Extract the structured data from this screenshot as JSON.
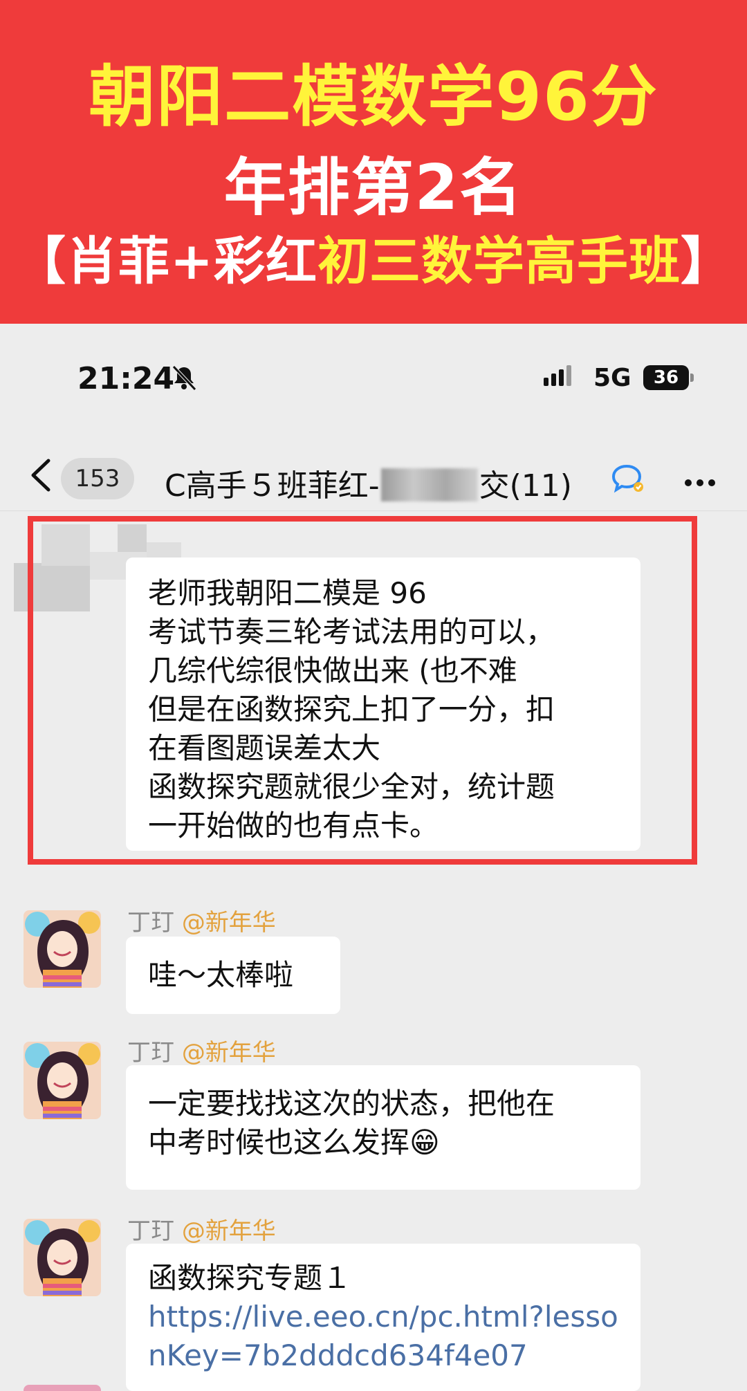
{
  "banner": {
    "line1": "朝阳二模数学96分",
    "line2": "年排第2名",
    "line3_white": "【肖菲+彩红",
    "line3_yellow": "初三数学高手班",
    "line3_end": "】",
    "colors": {
      "background": "#ef3b3b",
      "yellow": "#fff43a",
      "white": "#ffffff"
    }
  },
  "status_bar": {
    "time": "21:24",
    "network": "5G",
    "battery": "36",
    "icons": [
      "bell-muted-icon",
      "signal-icon",
      "battery-icon"
    ]
  },
  "chat_header": {
    "unread_count": "153",
    "title_prefix": "C高手５班菲红-",
    "title_suffix": "交",
    "title_tail": "(11)",
    "icons": [
      "back-arrow-icon",
      "chat-bubble-icon",
      "more-icon"
    ]
  },
  "messages": [
    {
      "highlighted": true,
      "lines": [
        "老师我朝阳二模是 96",
        "考试节奏三轮考试法用的可以，",
        "几综代综很快做出来 (也不难",
        "但是在函数探究上扣了一分，扣",
        "在看图题误差太大",
        "函数探究题就很少全对，统计题",
        "一开始做的也有点卡。"
      ]
    },
    {
      "sender": "丁玎",
      "mention": "@新年华",
      "lines": [
        "哇～太棒啦"
      ]
    },
    {
      "sender": "丁玎",
      "mention": "@新年华",
      "lines": [
        "一定要找找这次的状态，把他在",
        "中考时候也这么发挥😁"
      ]
    },
    {
      "sender": "丁玎",
      "mention": "@新年华",
      "lines": [
        "函数探究专题１"
      ],
      "link_lines": [
        "https://live.eeo.cn/pc.html?lesso",
        "nKey=7b2dddcd634f4e07"
      ]
    }
  ]
}
